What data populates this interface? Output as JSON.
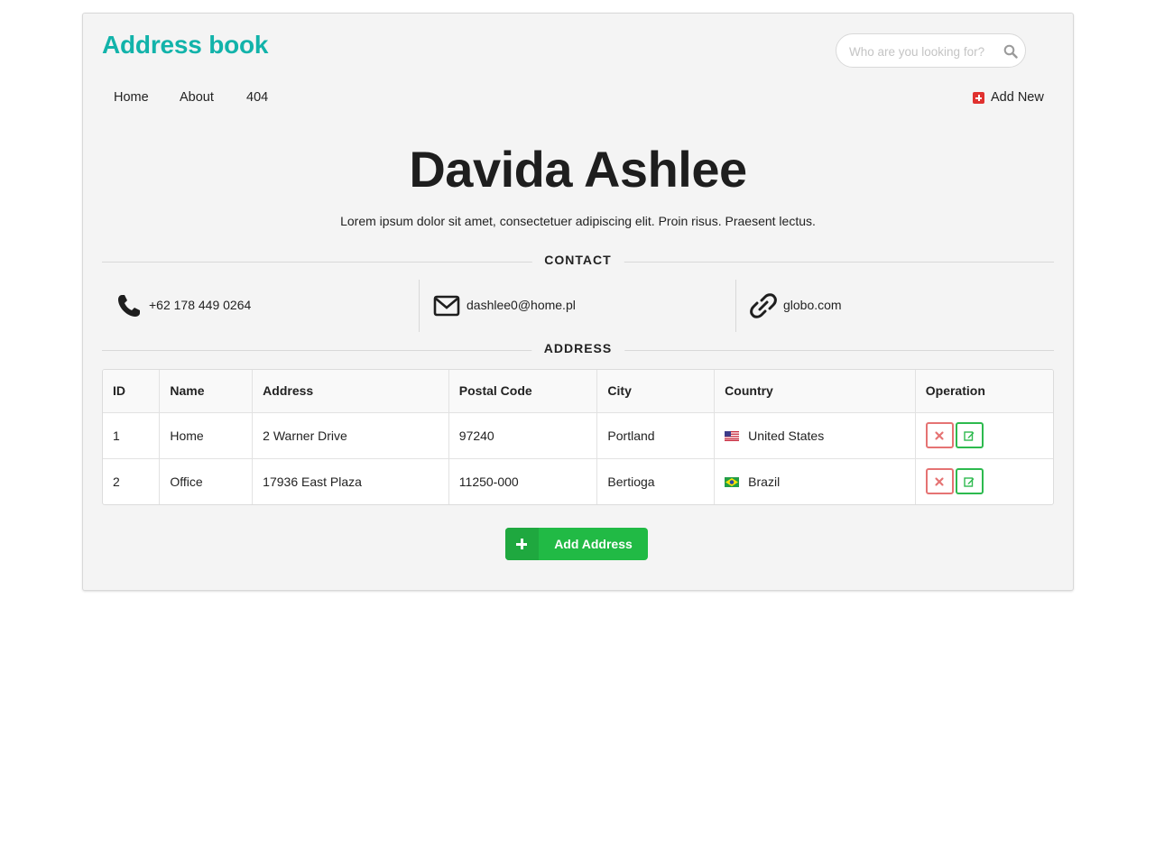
{
  "app": {
    "brand": "Address book"
  },
  "search": {
    "placeholder": "Who are you looking for?",
    "icon": "search-icon"
  },
  "nav": {
    "items": [
      {
        "label": "Home"
      },
      {
        "label": "About"
      },
      {
        "label": "404"
      }
    ],
    "add_new": {
      "label": "Add New",
      "icon": "plus-square-icon",
      "color": "#e0312f"
    }
  },
  "person": {
    "name": "Davida Ashlee",
    "description": "Lorem ipsum dolor sit amet, consectetuer adipiscing elit. Proin risus. Praesent lectus."
  },
  "contact_section": {
    "title": "CONTACT",
    "items": [
      {
        "icon": "phone-icon",
        "value": "+62 178 449 0264"
      },
      {
        "icon": "envelope-icon",
        "value": "dashlee0@home.pl"
      },
      {
        "icon": "link-icon",
        "value": "globo.com"
      }
    ]
  },
  "address_section": {
    "title": "ADDRESS",
    "columns": [
      "ID",
      "Name",
      "Address",
      "Postal Code",
      "City",
      "Country",
      "Operation"
    ],
    "rows": [
      {
        "id": "1",
        "name": "Home",
        "address": "2 Warner Drive",
        "postal_code": "97240",
        "city": "Portland",
        "country": "United States",
        "flag": "us-flag-icon"
      },
      {
        "id": "2",
        "name": "Office",
        "address": "17936 East Plaza",
        "postal_code": "11250-000",
        "city": "Bertioga",
        "country": "Brazil",
        "flag": "br-flag-icon"
      }
    ],
    "operations": {
      "delete_icon": "close-icon",
      "edit_icon": "edit-icon",
      "delete_color": "#e57373",
      "edit_color": "#2dba4e"
    }
  },
  "add_address_button": {
    "label": "Add Address",
    "icon": "plus-icon",
    "color": "#21ba45"
  },
  "colors": {
    "brand": "#12b3aa",
    "card_bg": "#f4f4f4"
  }
}
